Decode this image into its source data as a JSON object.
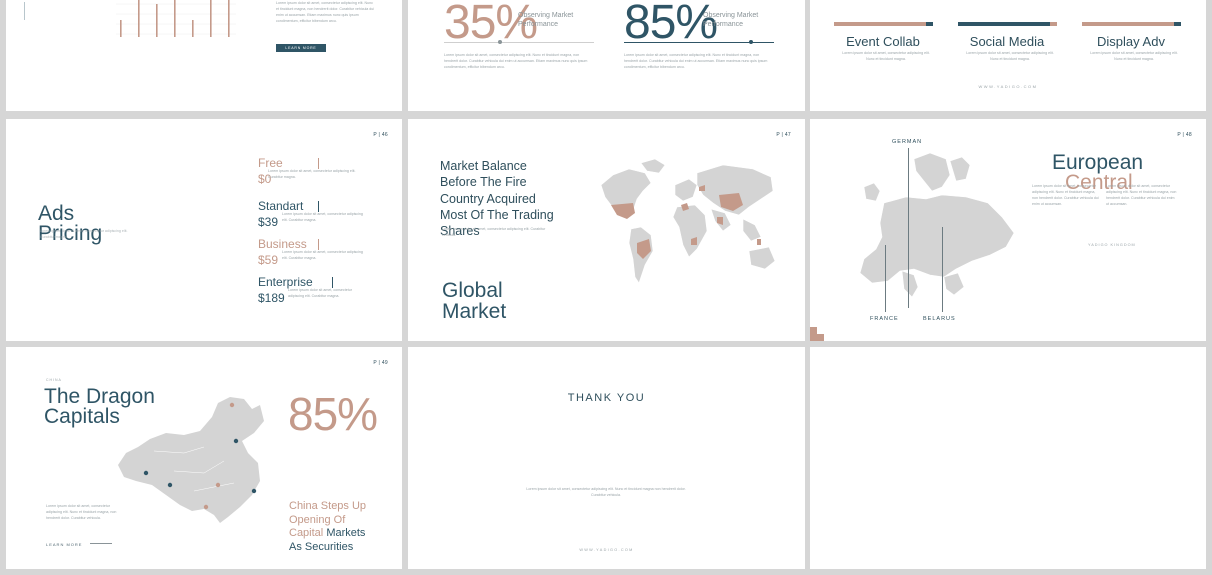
{
  "slide1": {
    "button": "LEARN MORE",
    "lorem": "Lorem ipsum dolor sit amet, consectetur adipiscing elit. Nunc et tincidunt magna, non hendrerit dolor. Curabitur vehicula dui enim ut accumsan. Etiam maximus nunc quis ipsum condimentum, efficitur bibendum arcu."
  },
  "slide2": {
    "pct1": "35%",
    "pct2": "85%",
    "label1": "Observing Market Performance",
    "label2": "Observing Market Performance",
    "lorem": "Lorem ipsum dolor sit amet, consectetur adipiscing elit. Nunc et tincidunt magna, non hendrerit dolor. Curabitur vehicula dui enim ut accumsan. Etiam maximus nunc quis ipsum condimentum, efficitur bibendum arcu."
  },
  "slide3": {
    "services": [
      {
        "title": "Event Collab",
        "bar_color": "#c49a8a",
        "accent_color": "#2f5566"
      },
      {
        "title": "Social Media",
        "bar_color": "#2f5566",
        "accent_color": "#c49a8a"
      },
      {
        "title": "Display Adv",
        "bar_color": "#c49a8a",
        "accent_color": "#2f5566"
      }
    ],
    "lorem": "Lorem ipsum dolor sit amet, consectetur adipiscing elit. Nunc et tincidunt magna.",
    "website": "WWW.YADIGO.COM"
  },
  "slide4": {
    "page": "P | 46",
    "title_line1": "Ads",
    "title_line2": "Pricing",
    "plans": [
      {
        "name": "Free",
        "price": "$0",
        "style": "rose"
      },
      {
        "name": "Standart",
        "price": "$39",
        "style": "dark"
      },
      {
        "name": "Business",
        "price": "$59",
        "style": "rose"
      },
      {
        "name": "Enterprise",
        "price": "$189",
        "style": "dark"
      }
    ],
    "lorem": "Lorem ipsum dolor sit amet, consectetur adipiscing elit. Curabitur magna."
  },
  "slide5": {
    "page": "P | 47",
    "lines": [
      "Market Balance",
      "Before The Fire",
      "Country Acquired",
      "Most Of The Trading",
      "Shares"
    ],
    "title_line1": "Global",
    "title_line2": "Market",
    "lorem": "Lorem ipsum dolor sit amet, consectetur adipiscing elit. Curabitur vehicula."
  },
  "slide6": {
    "page": "P | 48",
    "title_line1": "European",
    "title_line2": "Central",
    "label_german": "GERMAN",
    "label_france": "FRANCE",
    "label_belarus": "BELARUS",
    "subline": "YADIGO KINGDOM",
    "lorem": "Lorem ipsum dolor sit amet, consectetur adipiscing elit. Nunc et tincidunt magna, non hendrerit dolor. Curabitur vehicula dui enim ut accumsan."
  },
  "slide7": {
    "page": "P | 49",
    "kicker": "CHINA",
    "title_line1": "The Dragon",
    "title_line2": "Capitals",
    "pct": "85%",
    "caption_rose": "China Steps Up Opening Of Capital",
    "caption_dark": "Markets As Securities",
    "link": "LEARN MORE",
    "lorem": "Lorem ipsum dolor sit amet, consectetur adipiscing elit. Nunc et tincidunt magna, non hendrerit dolor. Curabitur vehicula."
  },
  "slide8": {
    "title": "THANK YOU",
    "lorem": "Lorem ipsum dolor sit amet, consectetur adipiscing elit. Nunc et tincidunt magna non hendrerit dolor. Curabitur vehicula.",
    "website": "WWW.YADIGO.COM"
  },
  "colors": {
    "rose": "#c49a8a",
    "navy": "#2f5566",
    "map_grey": "#d4d4d4"
  },
  "icons": [
    "chart-bars-icon",
    "world-map-icon",
    "europe-map-icon",
    "china-map-icon"
  ]
}
